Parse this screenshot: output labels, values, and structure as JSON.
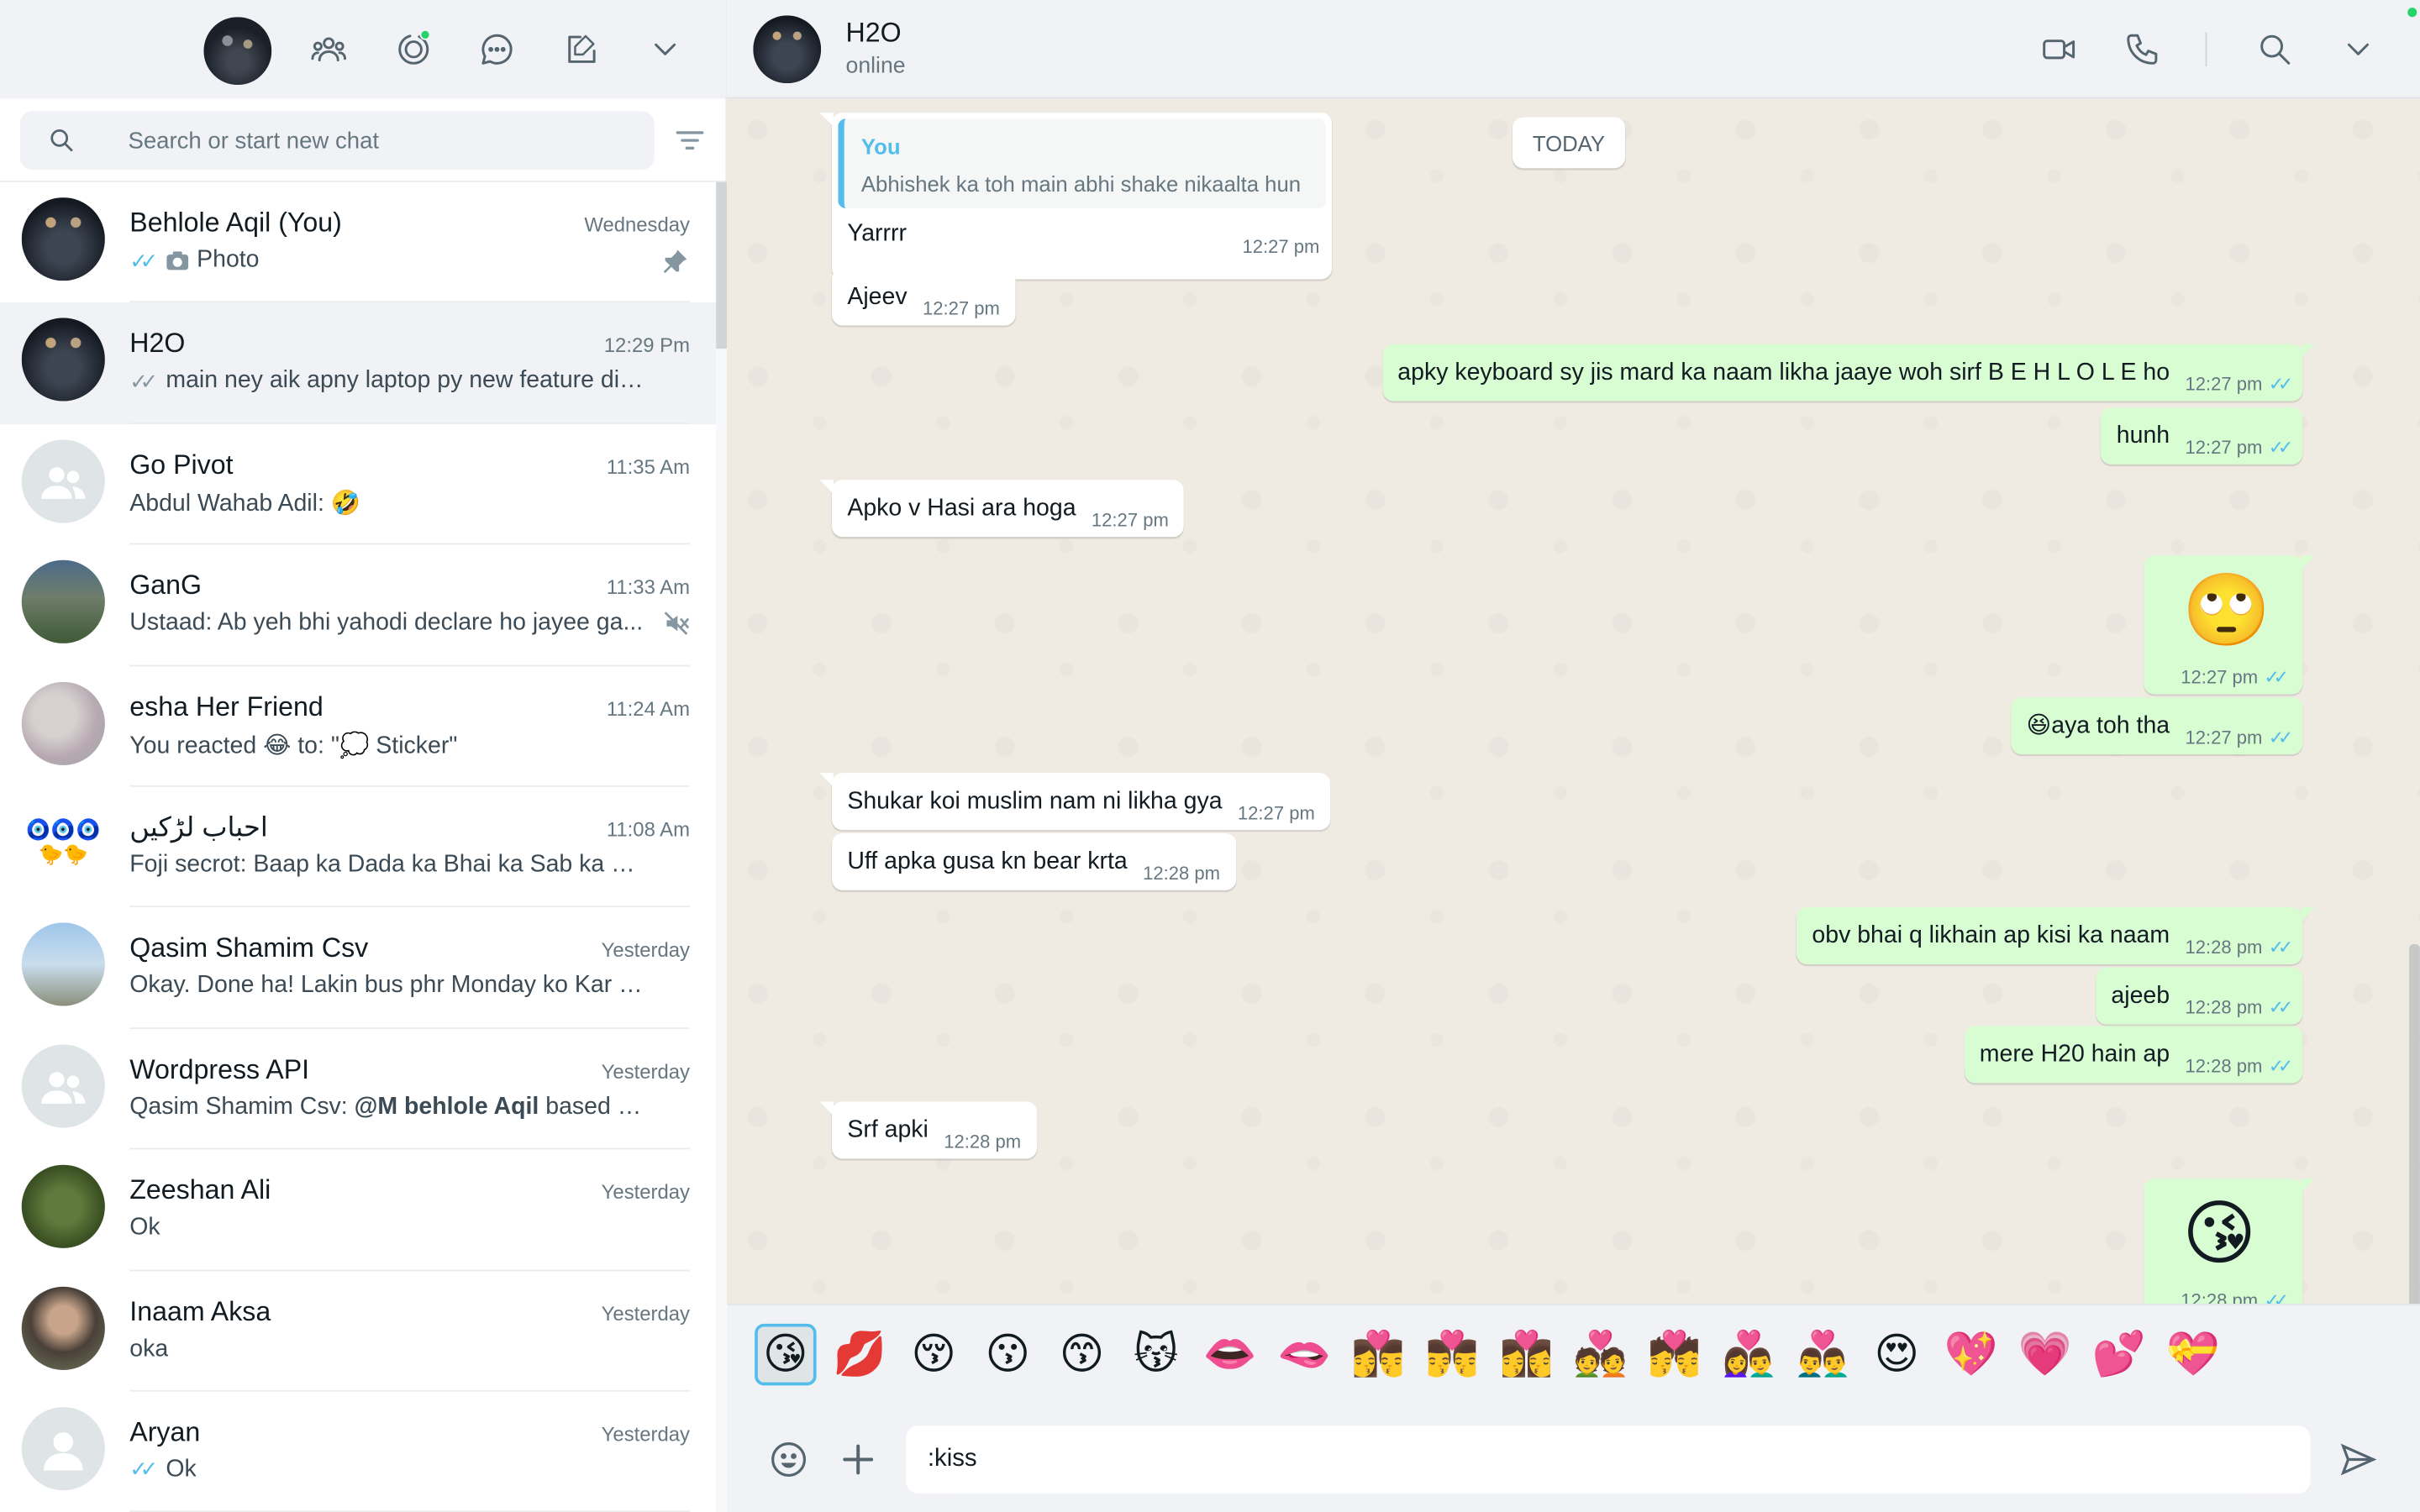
{
  "search": {
    "placeholder": "Search or start new chat"
  },
  "chats": [
    {
      "name": "Behlole Aqil (You)",
      "time": "Wednesday",
      "ticks": "✓✓",
      "preview_icon": "camera-icon",
      "preview": "Photo",
      "right_icon": "pin-icon"
    },
    {
      "name": "H2O",
      "time": "12:29 Pm",
      "ticks": "✓✓",
      "preview": "main ney aik apny laptop py new feature disc..."
    },
    {
      "name": "Go Pivot",
      "time": "11:35 Am",
      "preview": "Abdul Wahab Adil: 🤣"
    },
    {
      "name": "GanG",
      "time": "11:33 Am",
      "preview": "Ustaad: Ab yeh bhi yahodi declare ho jayee ga...",
      "right_icon": "muted-icon"
    },
    {
      "name": "esha Her Friend",
      "time": "11:24 Am",
      "preview": "You reacted 😂 to: \"💭 Sticker\""
    },
    {
      "name": "احباب لڑکیں",
      "time": "11:08 Am",
      "preview": "Foji secrot: Baap ka Dada ka Bhai ka Sab ka Badl..."
    },
    {
      "name": "Qasim Shamim Csv",
      "time": "Yesterday",
      "preview": "Okay. Done ha! Lakin bus phr Monday ko Kar dia ..."
    },
    {
      "name": "Wordpress API",
      "time": "Yesterday",
      "preview_prefix": "Qasim Shamim Csv: ",
      "preview_bold": "@M behlole Aqil",
      "preview": " based on y..."
    },
    {
      "name": "Zeeshan Ali",
      "time": "Yesterday",
      "preview": "Ok"
    },
    {
      "name": "Inaam Aksa",
      "time": "Yesterday",
      "preview": "oka"
    },
    {
      "name": "Aryan",
      "time": "Yesterday",
      "ticks": "✓✓",
      "preview": "Ok"
    }
  ],
  "conversation": {
    "name": "H2O",
    "status": "online",
    "date_chip": "TODAY",
    "reply": {
      "author": "You",
      "quoted": "Abhishek ka toh main abhi shake nikaalta hun",
      "text": "Yarrrr",
      "time": "12:27 pm"
    },
    "messages": [
      {
        "dir": "in",
        "text": "Ajeev",
        "time": "12:27 pm"
      },
      {
        "dir": "out",
        "text": "apky keyboard sy jis mard ka naam likha jaaye woh sirf B E H L O L E ho",
        "time": "12:27 pm",
        "ticks": "✓✓"
      },
      {
        "dir": "out",
        "text": "hunh",
        "time": "12:27 pm",
        "ticks": "✓✓"
      },
      {
        "dir": "in",
        "text": "Apko v Hasi ara hoga",
        "time": "12:27 pm"
      },
      {
        "dir": "out",
        "emoji": "🙄",
        "time": "12:27 pm",
        "ticks": "✓✓"
      },
      {
        "dir": "out",
        "text": "😆aya toh tha",
        "time": "12:27 pm",
        "ticks": "✓✓"
      },
      {
        "dir": "in",
        "text": "Shukar koi muslim nam ni likha gya",
        "time": "12:27 pm"
      },
      {
        "dir": "in",
        "text": "Uff apka gusa kn bear krta",
        "time": "12:28 pm"
      },
      {
        "dir": "out",
        "text": "obv bhai q likhain ap kisi ka naam",
        "time": "12:28 pm",
        "ticks": "✓✓"
      },
      {
        "dir": "out",
        "text": "ajeeb",
        "time": "12:28 pm",
        "ticks": "✓✓"
      },
      {
        "dir": "out",
        "text": "mere H20 hain ap",
        "time": "12:28 pm",
        "ticks": "✓✓"
      },
      {
        "dir": "in",
        "text": "Srf apki",
        "time": "12:28 pm"
      },
      {
        "dir": "out",
        "emoji": "😘",
        "time": "12:28 pm",
        "ticks": "✓✓"
      }
    ]
  },
  "emoji_suggestions": [
    "😘",
    "💋",
    "😚",
    "😗",
    "😙",
    "😽",
    "👄",
    "🫦",
    "👩‍❤️‍💋‍👨",
    "👨‍❤️‍💋‍👨",
    "👩‍❤️‍💋‍👩",
    "💑",
    "💏",
    "👩‍❤️‍👨",
    "👨‍❤️‍👨",
    "😍",
    "💖",
    "💗",
    "💕",
    "💝"
  ],
  "composer": {
    "value": ":kiss"
  },
  "colors": {
    "accent": "#25d366",
    "tick_blue": "#53bdeb",
    "outgoing_bubble": "#d9fdd3",
    "panel_bg": "#f0f2f5",
    "chat_bg": "#efeae2"
  }
}
